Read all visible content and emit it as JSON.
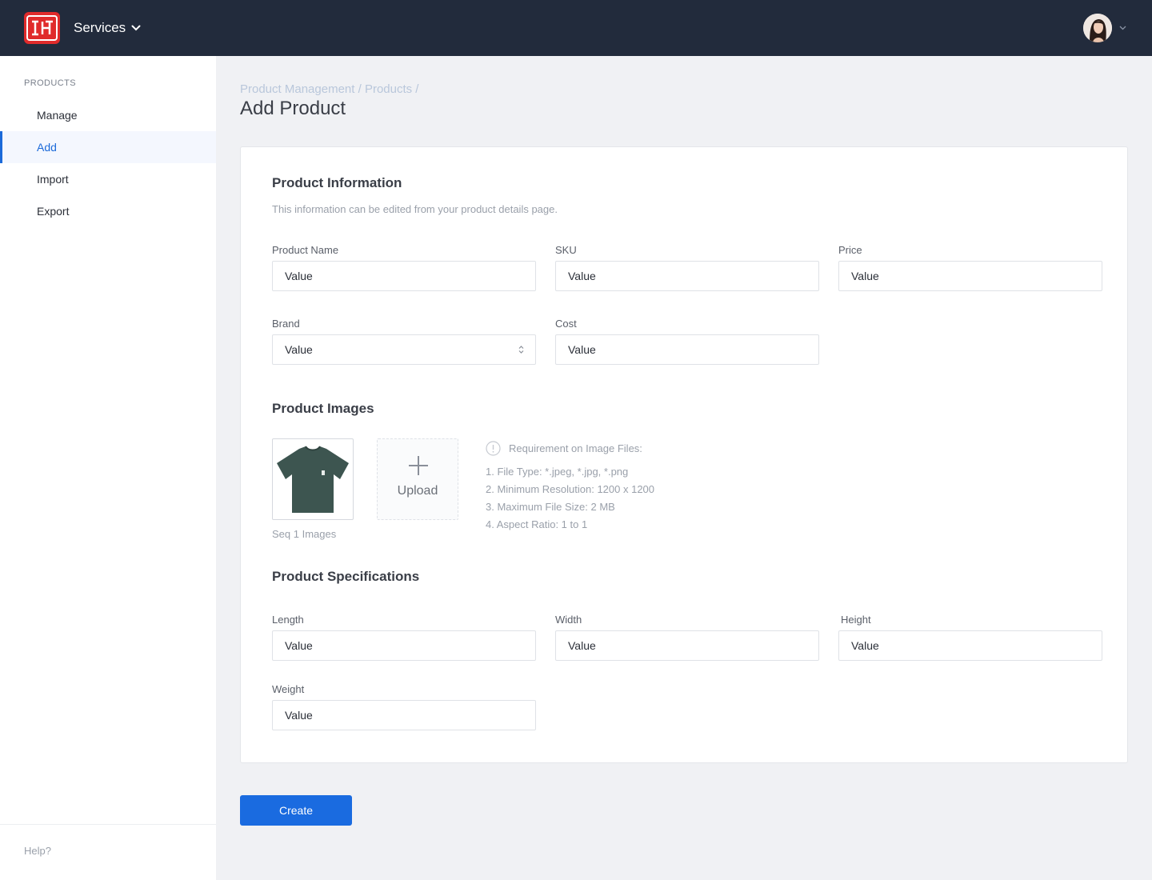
{
  "header": {
    "services_label": "Services",
    "logo_name": "brand-logo",
    "user_avatar": "user-avatar"
  },
  "sidebar": {
    "heading": "PRODUCTS",
    "items": [
      {
        "label": "Manage",
        "active": false
      },
      {
        "label": "Add",
        "active": true
      },
      {
        "label": "Import",
        "active": false
      },
      {
        "label": "Export",
        "active": false
      }
    ],
    "help": "Help?"
  },
  "breadcrumb": {
    "items": [
      "Product Management",
      "Products"
    ],
    "separator": " / "
  },
  "page_title": "Add Product",
  "product_info": {
    "title": "Product Information",
    "description": "This information can be edited from your product details page.",
    "fields": {
      "product_name": {
        "label": "Product Name",
        "value": "Value"
      },
      "sku": {
        "label": "SKU",
        "value": "Value"
      },
      "price": {
        "label": "Price",
        "value": "Value"
      },
      "brand": {
        "label": "Brand",
        "value": "Value"
      },
      "cost": {
        "label": "Cost",
        "value": "Value"
      }
    }
  },
  "product_images": {
    "title": "Product Images",
    "thumb_caption": "Seq 1 Images",
    "upload_label": "Upload",
    "requirements_title": "Requirement on Image Files:",
    "requirements": [
      "1. File Type: *.jpeg, *.jpg, *.png",
      "2. Minimum Resolution: 1200 x 1200",
      "3. Maximum File Size: 2 MB",
      "4. Aspect Ratio: 1 to 1"
    ]
  },
  "product_specs": {
    "title": "Product Specifications",
    "fields": {
      "length": {
        "label": "Length",
        "value": "Value"
      },
      "width": {
        "label": "Width",
        "value": "Value"
      },
      "height": {
        "label": "Height",
        "value": "Value"
      },
      "weight": {
        "label": "Weight",
        "value": "Value"
      }
    }
  },
  "actions": {
    "create_label": "Create"
  },
  "colors": {
    "topbar": "#222b3c",
    "accent": "#1a6be0",
    "logo": "#e02b2b",
    "tshirt": "#3d5550"
  }
}
